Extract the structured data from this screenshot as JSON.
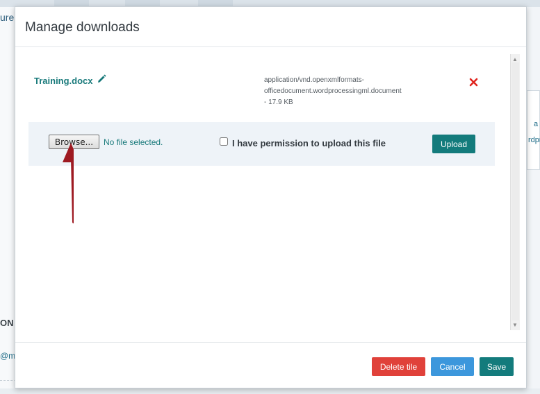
{
  "background": {
    "left_labels": [
      "ure",
      "ON",
      "@me"
    ],
    "right_labels": [
      "a",
      "rdpr"
    ]
  },
  "modal": {
    "title": "Manage downloads",
    "file": {
      "name": "Training.docx",
      "meta_line1": "application/vnd.openxmlformats-",
      "meta_line2": "officedocument.wordprocessingml.document",
      "meta_line3": "- 17.9 KB"
    },
    "upload": {
      "browse_label": "Browse...",
      "no_file_text": "No file selected.",
      "permission_label": "I have permission to upload this file",
      "upload_label": "Upload"
    },
    "footer": {
      "delete_tile_label": "Delete tile",
      "cancel_label": "Cancel",
      "save_label": "Save"
    }
  },
  "icons": {
    "edit": "pencil-icon",
    "remove": "red-x-icon"
  },
  "colors": {
    "teal": "#137b7c",
    "danger": "#e0413a",
    "info": "#3c97dc",
    "remove_icon": "#e0241d",
    "annotation_arrow": "#9e1a22"
  }
}
